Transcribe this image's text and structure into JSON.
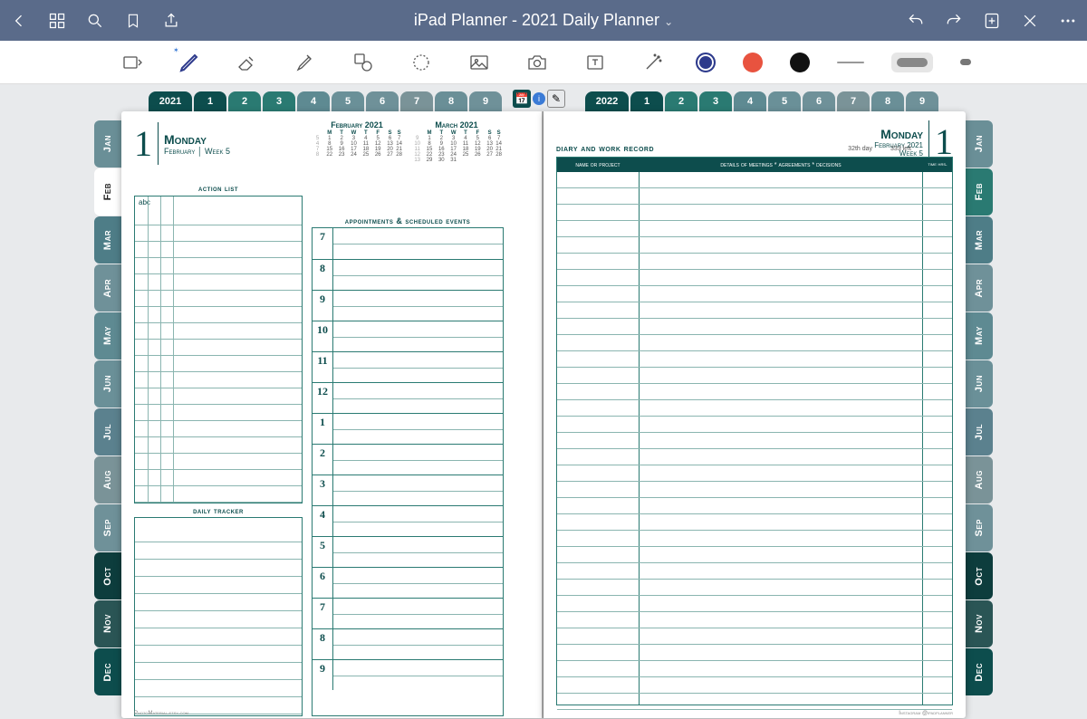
{
  "title": "iPad Planner - 2021 Daily Planner",
  "colors": {
    "swatch1": "#2d3a8c",
    "swatch2": "#e8533f",
    "swatch3": "#111"
  },
  "months": [
    "Jan",
    "Feb",
    "Mar",
    "Apr",
    "May",
    "Jun",
    "Jul",
    "Aug",
    "Sep",
    "Oct",
    "Nov",
    "Dec"
  ],
  "monthColors": [
    "#6a8f97",
    "#ffffff",
    "#4e7d87",
    "#6f9199",
    "#5e8a92",
    "#6a9098",
    "#5b818e",
    "#7a9398",
    "#6f9199",
    "#0d3d3d",
    "#2a5555",
    "#0d4d4d"
  ],
  "monthColorsR": [
    "#6a8f97",
    "#2a7a72",
    "#4e7d87",
    "#6f9199",
    "#5e8a92",
    "#6a9098",
    "#5b818e",
    "#7a9398",
    "#6f9199",
    "#0d3d3d",
    "#2a5555",
    "#0d4d4d"
  ],
  "activeLeft": 1,
  "topTabs": {
    "leftYear": "2021",
    "rightYear": "2022",
    "nums": [
      "1",
      "2",
      "3",
      "4",
      "5",
      "6",
      "7",
      "8",
      "9"
    ],
    "colors": [
      "#0d4d4d",
      "#2a7a72",
      "#2a7a72",
      "#5e8a92",
      "#6a9098",
      "#6f9199",
      "#7a9398",
      "#6a8f97",
      "#6f9199"
    ]
  },
  "leftPage": {
    "dateNum": "1",
    "day": "Monday",
    "month": "February",
    "week": "Week 5",
    "actionTitle": "action  list",
    "actionCols": {
      "a": "abc"
    },
    "trackerTitle": "daily tracker",
    "apptTitle": "appointments & scheduled events",
    "hours": [
      "7",
      "8",
      "9",
      "10",
      "11",
      "12",
      "1",
      "2",
      "3",
      "4",
      "5",
      "6",
      "7",
      "8",
      "9"
    ],
    "cal1": {
      "title": "February 2021",
      "dow": [
        "M",
        "T",
        "W",
        "T",
        "F",
        "S",
        "S"
      ],
      "rows": [
        [
          "5",
          "1",
          "2",
          "3",
          "4",
          "5",
          "6",
          "7"
        ],
        [
          "4",
          "8",
          "9",
          "10",
          "11",
          "12",
          "13",
          "14"
        ],
        [
          "7",
          "15",
          "16",
          "17",
          "18",
          "19",
          "20",
          "21"
        ],
        [
          "8",
          "22",
          "23",
          "24",
          "25",
          "26",
          "27",
          "28"
        ]
      ]
    },
    "cal2": {
      "title": "March 2021",
      "dow": [
        "M",
        "T",
        "W",
        "T",
        "F",
        "S",
        "S"
      ],
      "rows": [
        [
          "9",
          "1",
          "2",
          "3",
          "4",
          "5",
          "6",
          "7"
        ],
        [
          "10",
          "8",
          "9",
          "10",
          "11",
          "12",
          "13",
          "14"
        ],
        [
          "11",
          "15",
          "16",
          "17",
          "18",
          "19",
          "20",
          "21"
        ],
        [
          "12",
          "22",
          "23",
          "24",
          "25",
          "26",
          "27",
          "28"
        ],
        [
          "13",
          "29",
          "30",
          "31",
          "",
          "",
          "",
          ""
        ]
      ]
    },
    "footer": "PhotoMaterial.etsy.com"
  },
  "rightPage": {
    "dateNum": "1",
    "day": "Monday",
    "sub": "February 2021",
    "week": "Week 5",
    "stat1": "32th day",
    "stat2": "333 left",
    "diaryTitle": "diary and work record",
    "hdr": {
      "c1": "name or project",
      "c2": "details of meetings * agreements * decisions",
      "c3": "time hrs."
    },
    "footer": "Instagram @ipadplanner"
  }
}
